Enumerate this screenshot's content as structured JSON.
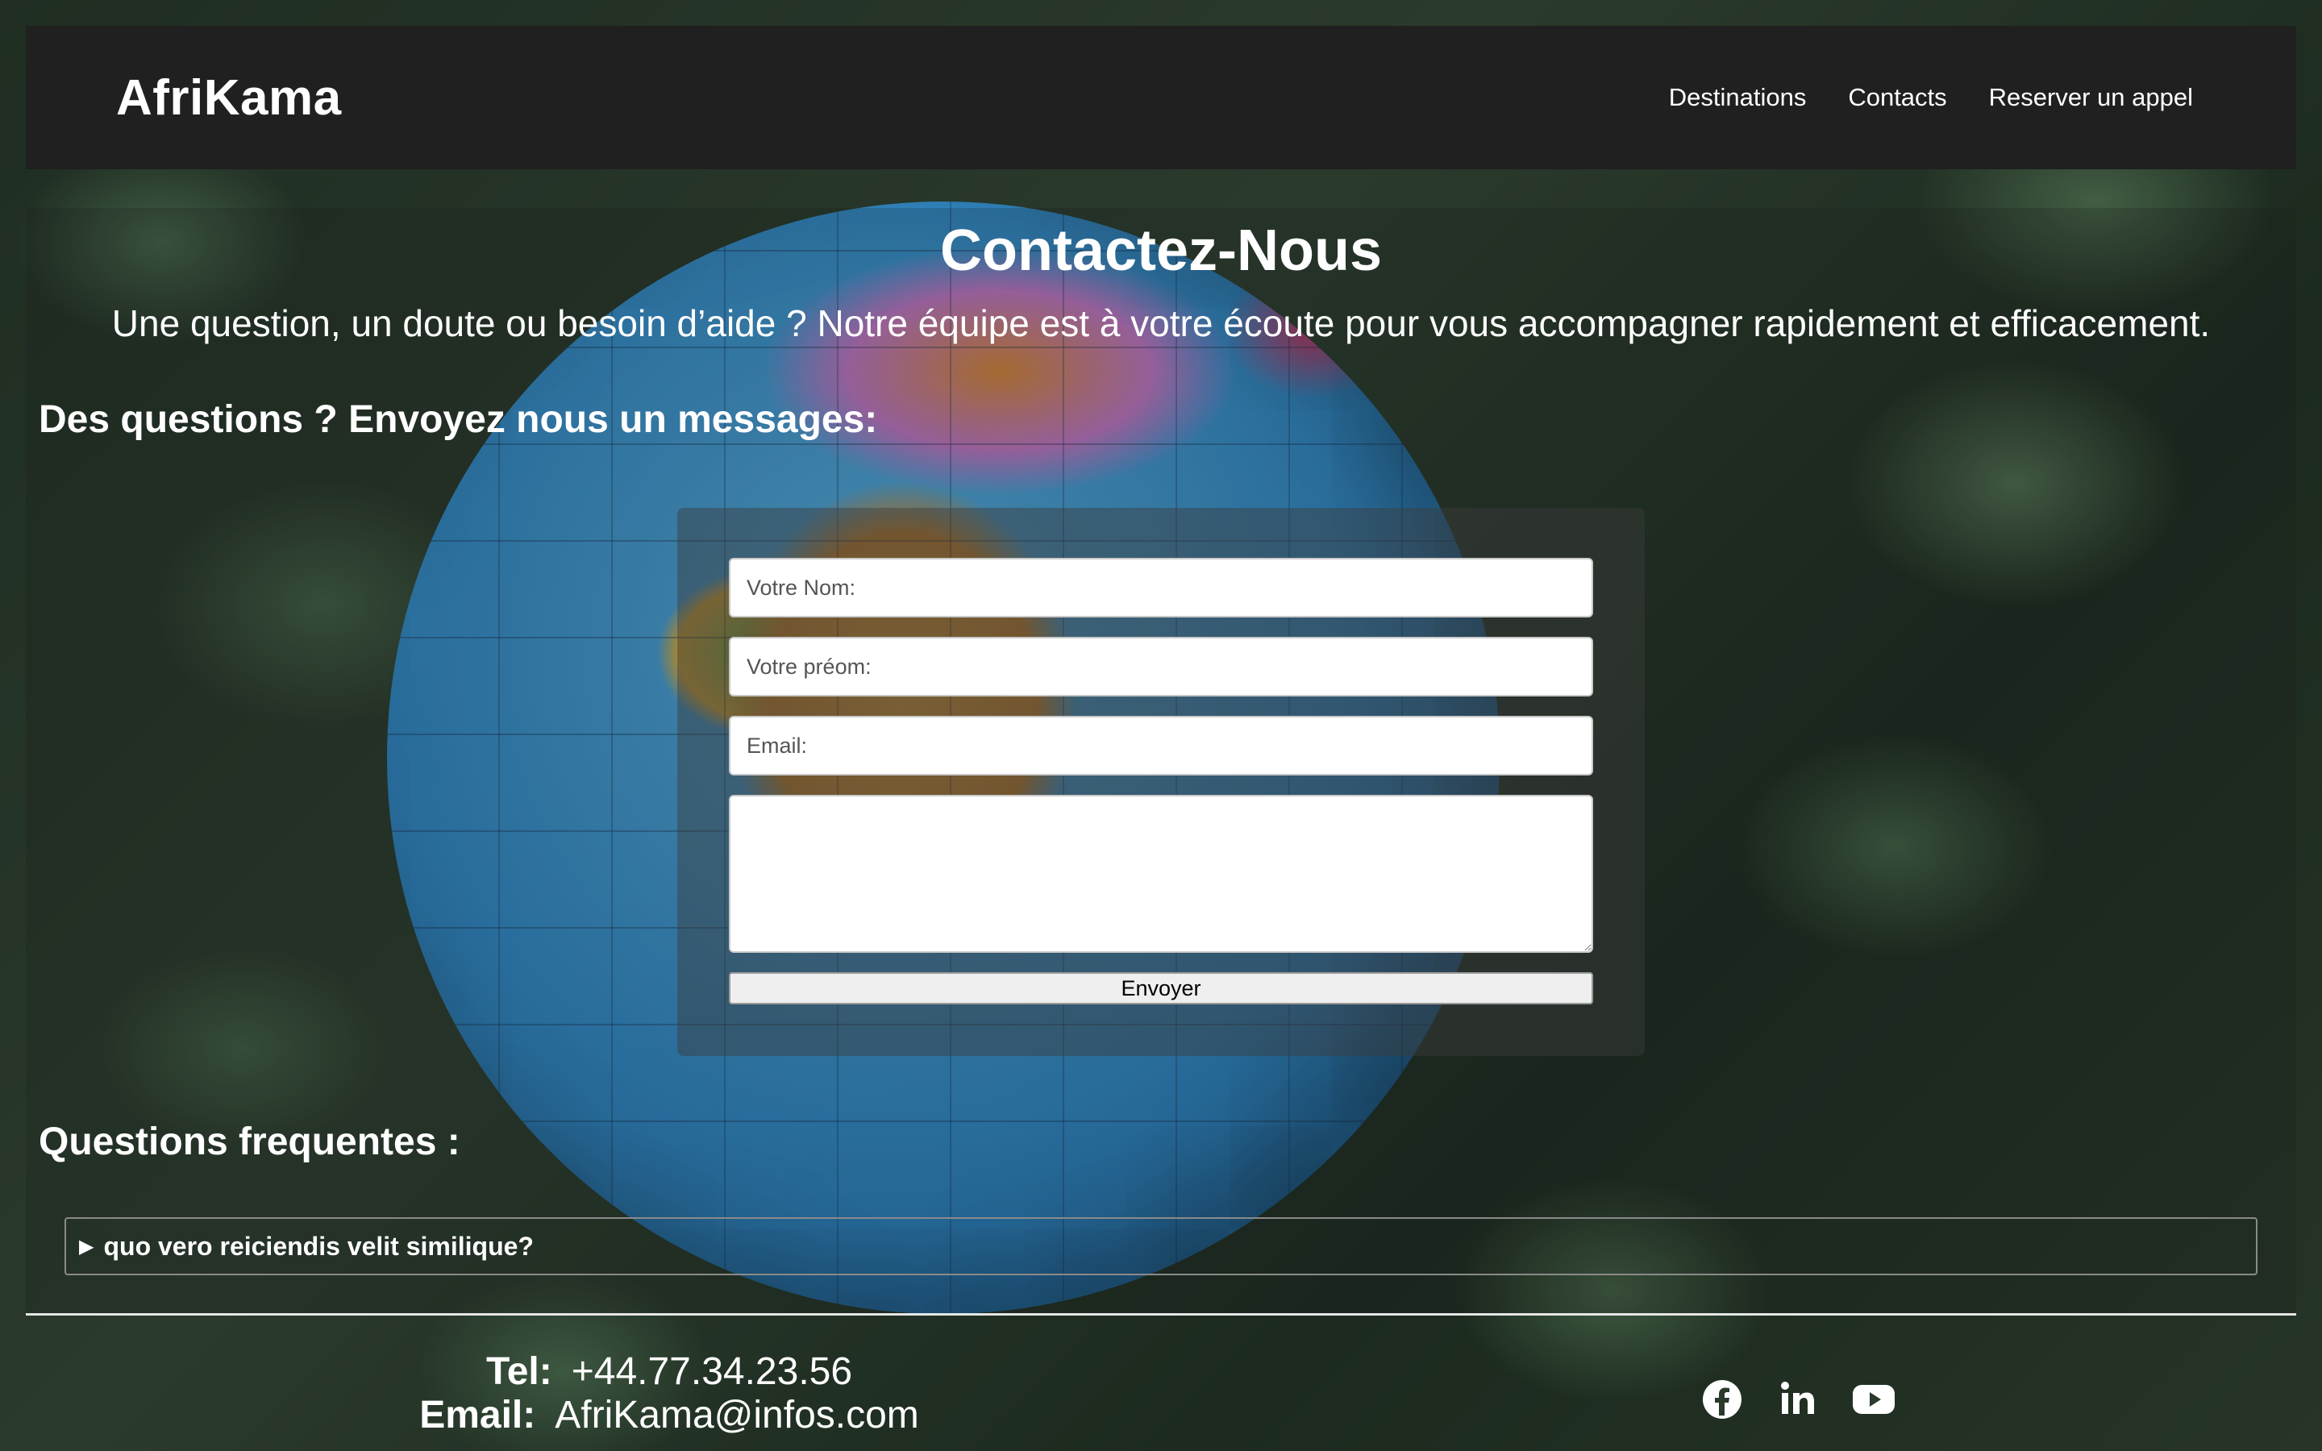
{
  "header": {
    "brand": "AfriKama",
    "nav": [
      "Destinations",
      "Contacts",
      "Reserver un appel"
    ]
  },
  "main": {
    "title": "Contactez-Nous",
    "intro": "Une question, un doute ou besoin d’aide ? Notre équipe est à votre écoute pour vous accompagner rapidement et efficacement.",
    "form_heading": "Des questions ? Envoyez nous un messages:",
    "form": {
      "nom_placeholder": "Votre Nom:",
      "prenom_placeholder": "Votre préom:",
      "email_placeholder": "Email:",
      "message_value": "",
      "submit_label": "Envoyer"
    },
    "faq_heading": "Questions frequentes :",
    "faq": [
      {
        "question": "quo vero reiciendis velit similique?",
        "expanded": false
      }
    ]
  },
  "footer": {
    "tel_label": "Tel:",
    "tel_value": "+44.77.34.23.56",
    "email_label": "Email:",
    "email_value": "AfriKama@infos.com",
    "socials": [
      "facebook-icon",
      "linkedin-icon",
      "youtube-icon"
    ]
  },
  "colors": {
    "navbar_bg": "#202020",
    "text": "#ffffff"
  }
}
